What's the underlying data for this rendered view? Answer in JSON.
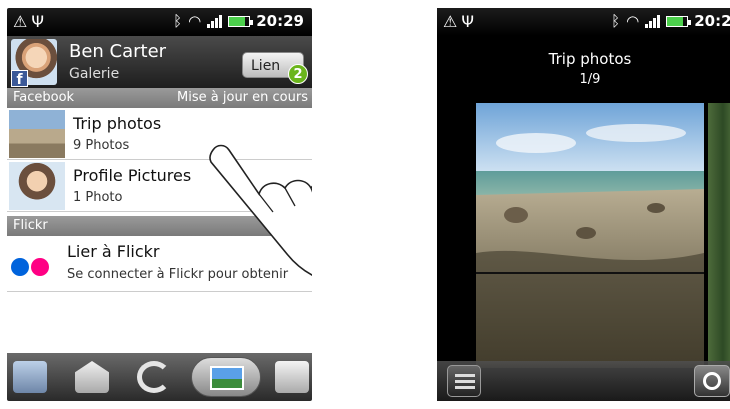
{
  "status_time": "20:29",
  "left": {
    "profile": {
      "name": "Ben  Carter",
      "subtitle": "Galerie",
      "link_button": "Lien",
      "badge_count": "2"
    },
    "sections": {
      "facebook": {
        "label": "Facebook",
        "status": "Mise à jour en cours"
      },
      "flickr": {
        "label": "Flickr"
      }
    },
    "albums": [
      {
        "title": "Trip photos",
        "subtitle": "9 Photos"
      },
      {
        "title": "Profile Pictures",
        "subtitle": "1 Photo"
      }
    ],
    "flickr_row": {
      "title": "Lier à Flickr",
      "subtitle": "Se connecter à Flickr pour obtenir"
    },
    "tabs": [
      "messages-tab-icon",
      "mail-tab-icon",
      "sync-tab-icon",
      "gallery-tab-icon",
      "more-tab-icon"
    ]
  },
  "right": {
    "album_title": "Trip photos",
    "counter": "1/9"
  },
  "colors": {
    "facebook": "#3b5998",
    "flickr_blue": "#0063dc",
    "flickr_pink": "#ff0084",
    "badge": "#6bb51c"
  }
}
